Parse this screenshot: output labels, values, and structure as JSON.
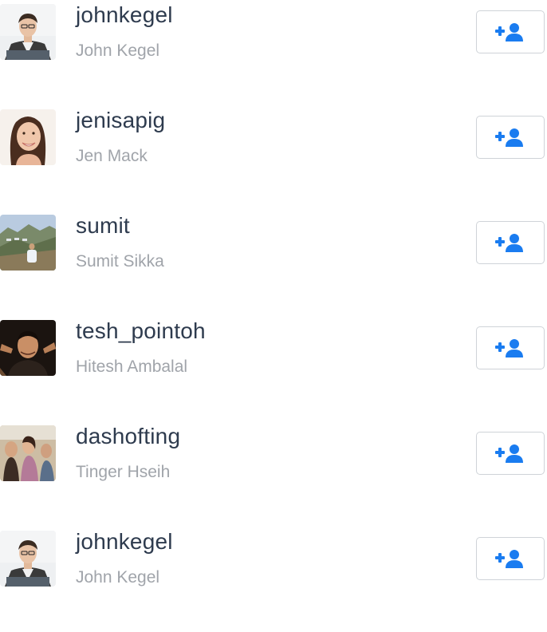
{
  "users": [
    {
      "username": "johnkegel",
      "full_name": "John Kegel",
      "avatar_icon": "avatar-man-suit-photo"
    },
    {
      "username": "jenisapig",
      "full_name": "Jen Mack",
      "avatar_icon": "avatar-woman-smiling-photo"
    },
    {
      "username": "sumit",
      "full_name": "Sumit Sikka",
      "avatar_icon": "avatar-hills-landscape-photo"
    },
    {
      "username": "tesh_pointoh",
      "full_name": "Hitesh Ambalal",
      "avatar_icon": "avatar-man-pointing-photo"
    },
    {
      "username": "dashofting",
      "full_name": "Tinger Hseih",
      "avatar_icon": "avatar-party-group-photo"
    },
    {
      "username": "johnkegel",
      "full_name": "John Kegel",
      "avatar_icon": "avatar-man-suit-photo"
    }
  ],
  "follow_button": {
    "icon": "add-user-icon",
    "icon_color": "#1a7cf0"
  },
  "colors": {
    "username": "#2e3b4e",
    "full_name": "#a0a4aa",
    "button_border": "#cfd3d8",
    "background": "#ffffff"
  }
}
